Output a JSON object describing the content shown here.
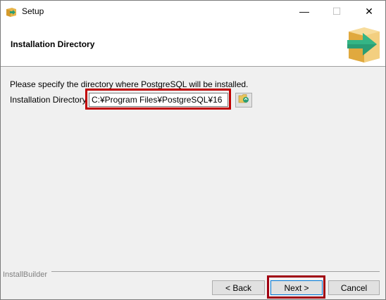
{
  "window": {
    "title": "Setup",
    "icon": "installer-box-icon",
    "controls": {
      "minimize": "—",
      "maximize": "☐",
      "close": "✕"
    }
  },
  "header": {
    "title": "Installation Directory",
    "logo_icon": "installer-box-arrow-icon"
  },
  "body": {
    "prompt": "Please specify the directory where PostgreSQL will be installed.",
    "dir_label": "Installation Directory",
    "dir_value": "C:¥Program Files¥PostgreSQL¥16",
    "browse_icon": "folder-browse-icon"
  },
  "footer": {
    "brand": "InstallBuilder",
    "back_label": "< Back",
    "next_label": "Next >",
    "cancel_label": "Cancel"
  },
  "colors": {
    "highlight": "#c00000",
    "logo_box": "#e8b54a",
    "logo_arrow": "#2a9d74"
  }
}
